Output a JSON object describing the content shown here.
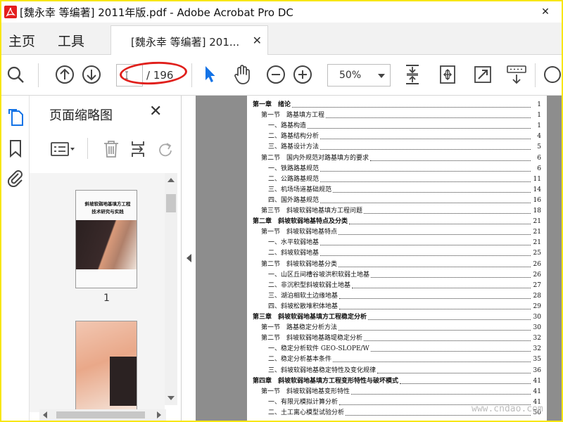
{
  "window": {
    "title": "[魏永幸 等编著] 2011年版.pdf - Adobe Acrobat Pro DC",
    "close_glyph": "✕"
  },
  "menu": {
    "home": "主页",
    "tools": "工具"
  },
  "tab": {
    "label": "[魏永幸 等编著] 201...",
    "close_glyph": "✕"
  },
  "toolbar": {
    "page_total": "/ 196",
    "page_value": "",
    "zoom_value": "50%",
    "accent_color": "#1473e6"
  },
  "panel": {
    "title": "页面缩略图",
    "close_glyph": "✕"
  },
  "thumbnails": [
    {
      "title": "斜坡软弱地基填方工程技术研究与实践",
      "number": "1"
    },
    {
      "number": ""
    }
  ],
  "toc": [
    {
      "label": "第一章　绪论",
      "page": "1",
      "level": 0
    },
    {
      "label": "第一节　路基填方工程",
      "page": "1",
      "level": 1
    },
    {
      "label": "一、路基构造",
      "page": "1",
      "level": 2
    },
    {
      "label": "二、路基结构分析",
      "page": "4",
      "level": 2
    },
    {
      "label": "三、路基设计方法",
      "page": "5",
      "level": 2
    },
    {
      "label": "第二节　国内外规范对路基填方的要求",
      "page": "6",
      "level": 1
    },
    {
      "label": "一、铁路路基规范",
      "page": "6",
      "level": 2
    },
    {
      "label": "二、公路路基规范",
      "page": "11",
      "level": 2
    },
    {
      "label": "三、机场场道基础规范",
      "page": "14",
      "level": 2
    },
    {
      "label": "四、国外路基规范",
      "page": "16",
      "level": 2
    },
    {
      "label": "第三节　斜坡软弱地基填方工程问题",
      "page": "18",
      "level": 1
    },
    {
      "label": "第二章　斜坡软弱地基特点及分类",
      "page": "21",
      "level": 0
    },
    {
      "label": "第一节　斜坡软弱地基特点",
      "page": "21",
      "level": 1
    },
    {
      "label": "一、水平软弱地基",
      "page": "21",
      "level": 2
    },
    {
      "label": "二、斜坡软弱地基",
      "page": "25",
      "level": 2
    },
    {
      "label": "第二节　斜坡软弱地基分类",
      "page": "26",
      "level": 1
    },
    {
      "label": "一、山区丘间槽谷坡洪积软弱土地基",
      "page": "26",
      "level": 2
    },
    {
      "label": "二、非沉积型斜坡软弱土地基",
      "page": "27",
      "level": 2
    },
    {
      "label": "三、湖泊相软土边缘地基",
      "page": "28",
      "level": 2
    },
    {
      "label": "四、斜坡松散堆积体地基",
      "page": "29",
      "level": 2
    },
    {
      "label": "第三章　斜坡软弱地基填方工程稳定分析",
      "page": "30",
      "level": 0
    },
    {
      "label": "第一节　路基稳定分析方法",
      "page": "30",
      "level": 1
    },
    {
      "label": "第二节　斜坡软弱地基路堤稳定分析",
      "page": "32",
      "level": 1
    },
    {
      "label": "一、稳定分析软件 GEO-SLOPE/W",
      "page": "32",
      "level": 2
    },
    {
      "label": "二、稳定分析基本条件",
      "page": "35",
      "level": 2
    },
    {
      "label": "三、斜坡软弱地基稳定特性及变化规律",
      "page": "36",
      "level": 2
    },
    {
      "label": "第四章　斜坡软弱地基填方工程变形特性与破坏模式",
      "page": "41",
      "level": 0
    },
    {
      "label": "第一节　斜坡软弱地基变形特性",
      "page": "41",
      "level": 1
    },
    {
      "label": "一、有限元模拟计算分析",
      "page": "41",
      "level": 2
    },
    {
      "label": "二、土工离心模型试验分析",
      "page": "50",
      "level": 2
    }
  ],
  "watermark": "www.cndao.com"
}
